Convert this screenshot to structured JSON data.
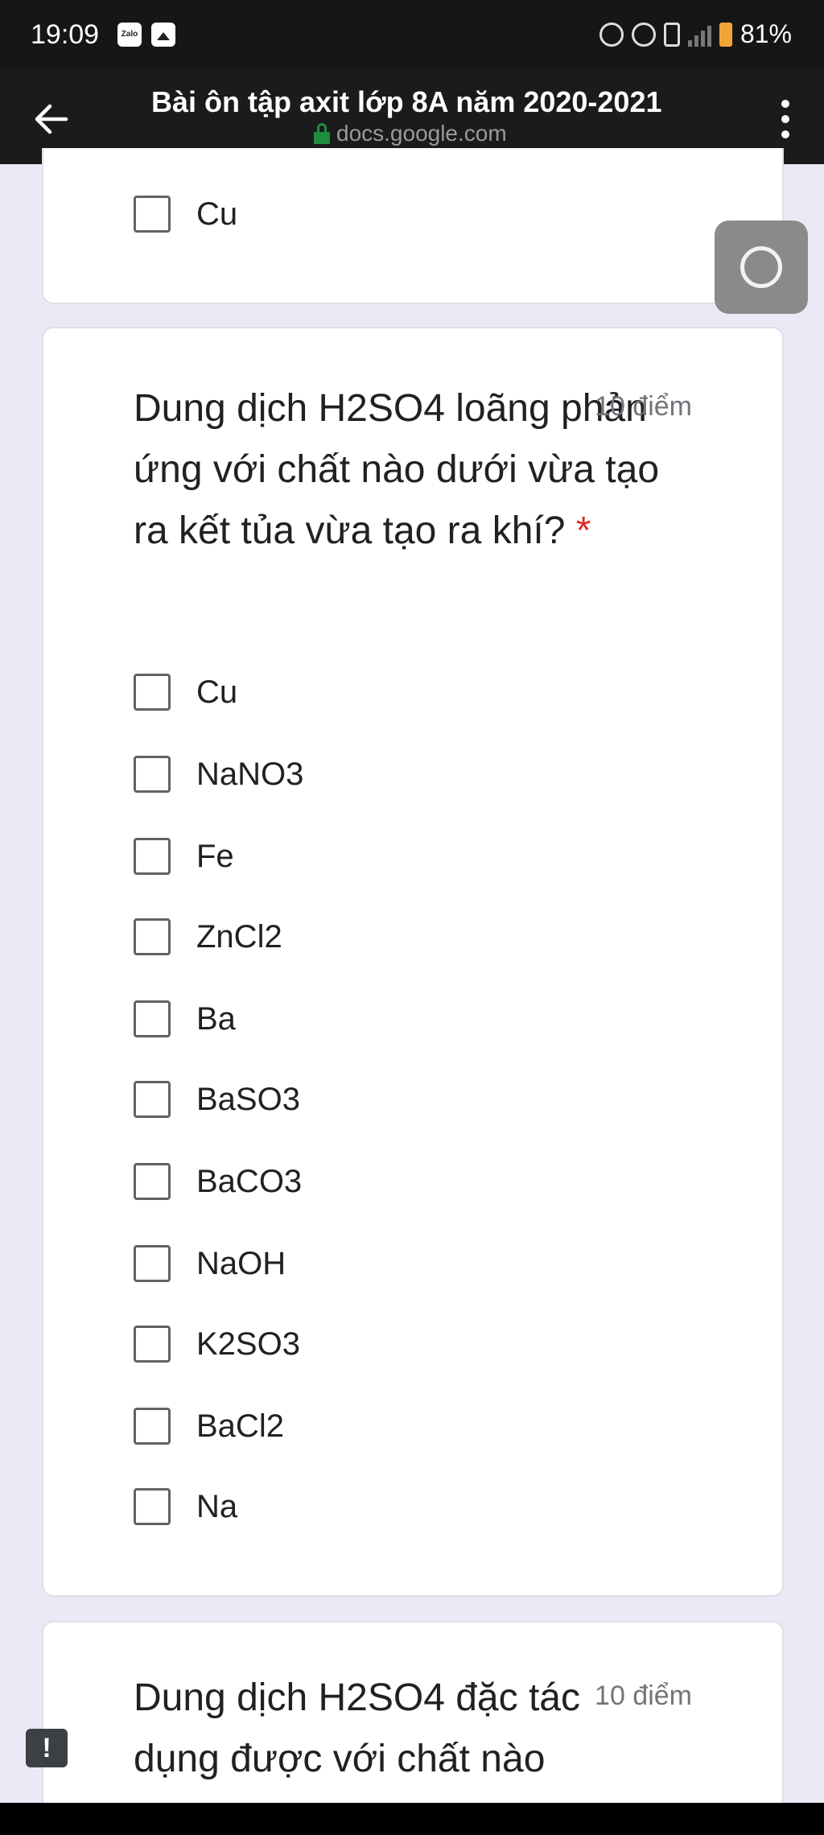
{
  "status_bar": {
    "time": "19:09",
    "zalo_label": "Zalo",
    "battery_percent": "81%",
    "icons": [
      "zalo-icon",
      "gallery-icon",
      "alarm-icon",
      "data-saver-icon",
      "vibrate-icon",
      "signal-icon",
      "battery-icon"
    ]
  },
  "app_bar": {
    "title": "Bài ôn tập axit lớp 8A năm 2020-2021",
    "url": "docs.google.com"
  },
  "previous_question": {
    "last_option": "Cu"
  },
  "question_main": {
    "text": "Dung dịch H2SO4 loãng phản ứng với chất nào dưới vừa tạo ra kết tủa vừa tạo ra khí?",
    "required_mark": "*",
    "points": "10 điểm",
    "options": [
      "Cu",
      "NaNO3",
      "Fe",
      "ZnCl2",
      "Ba",
      "BaSO3",
      "BaCO3",
      "NaOH",
      "K2SO3",
      "BaCl2",
      "Na"
    ]
  },
  "question_next": {
    "text": "Dung dịch H2SO4 đặc tác dụng được với chất nào",
    "points": "10 điểm"
  },
  "feedback_icon_label": "!",
  "colors": {
    "background": "#ece8f6",
    "required": "#d93025",
    "lock": "#1e8e3e"
  }
}
